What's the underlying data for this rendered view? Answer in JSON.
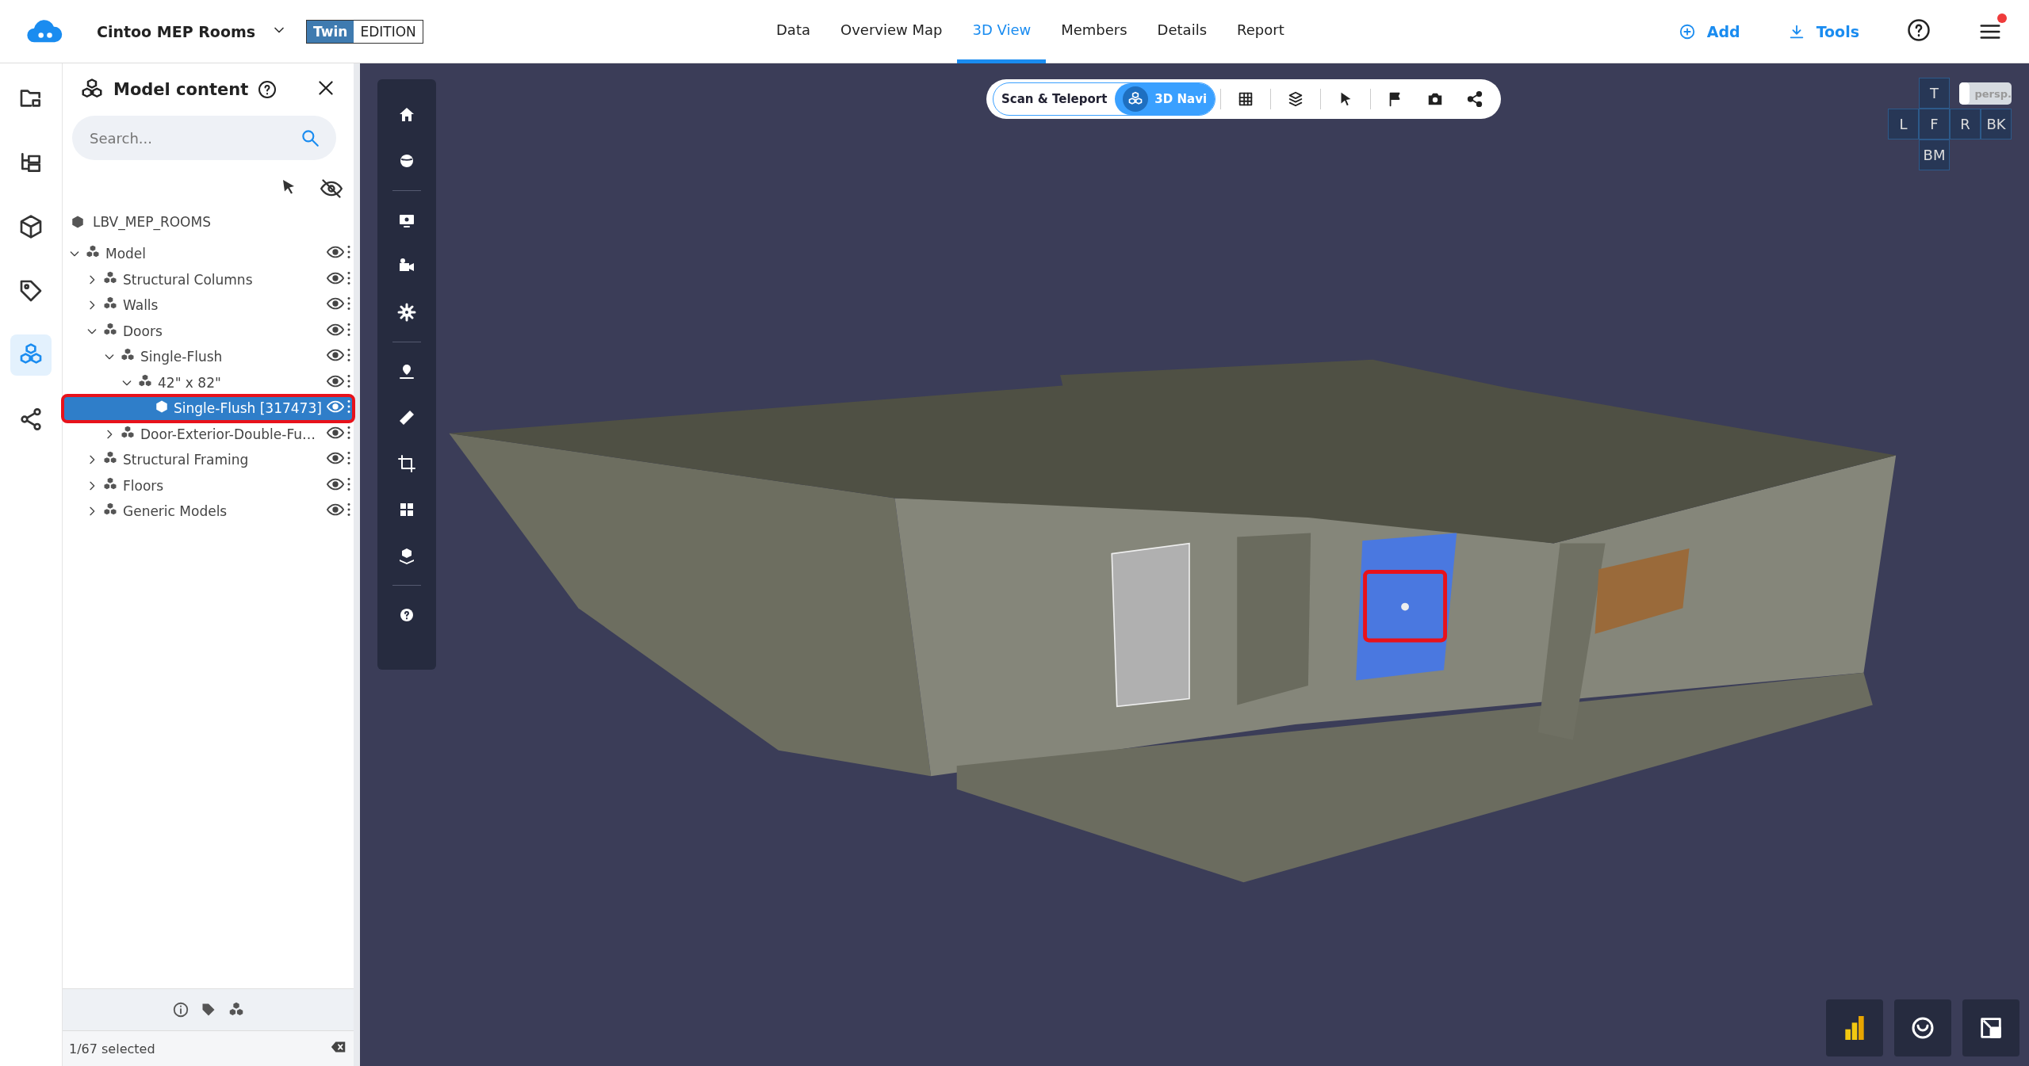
{
  "app": {
    "project": "Cintoo MEP Rooms",
    "edition_primary": "Twin",
    "edition_secondary": "EDITION"
  },
  "nav_tabs": [
    {
      "label": "Data",
      "selected": false
    },
    {
      "label": "Overview Map",
      "selected": false
    },
    {
      "label": "3D View",
      "selected": true
    },
    {
      "label": "Members",
      "selected": false
    },
    {
      "label": "Details",
      "selected": false
    },
    {
      "label": "Report",
      "selected": false
    }
  ],
  "header_actions": [
    {
      "kind": "add",
      "label": "Add"
    },
    {
      "kind": "tools",
      "label": "Tools"
    }
  ],
  "menu": {
    "has_notification": true
  },
  "rail_items": [
    {
      "kind": "folder",
      "selected": false
    },
    {
      "kind": "tree",
      "selected": false
    },
    {
      "kind": "cube",
      "selected": false
    },
    {
      "kind": "tag",
      "selected": false
    },
    {
      "kind": "model",
      "selected": true
    },
    {
      "kind": "share",
      "selected": false
    }
  ],
  "panel": {
    "title": "Model content",
    "search_placeholder": "Search...",
    "root": "LBV_MEP_ROOMS",
    "status": "1/67 selected",
    "tree": [
      {
        "label": "Model",
        "kind": "group",
        "expanded": true,
        "selected": false,
        "children": [
          {
            "label": "Structural Columns",
            "kind": "group",
            "expanded": false,
            "selected": false
          },
          {
            "label": "Walls",
            "kind": "group",
            "expanded": false,
            "selected": false
          },
          {
            "label": "Doors",
            "kind": "group",
            "expanded": true,
            "selected": false,
            "children": [
              {
                "label": "Single-Flush",
                "kind": "group",
                "expanded": true,
                "selected": false,
                "children": [
                  {
                    "label": "42\" x 82\"",
                    "kind": "group",
                    "expanded": true,
                    "selected": false,
                    "children": [
                      {
                        "label": "Single-Flush [317473]",
                        "kind": "element",
                        "selected": true
                      }
                    ]
                  }
                ]
              },
              {
                "label": "Door-Exterior-Double-Fu…",
                "kind": "group",
                "expanded": false,
                "selected": false
              }
            ]
          },
          {
            "label": "Structural Framing",
            "kind": "group",
            "expanded": false,
            "selected": false
          },
          {
            "label": "Floors",
            "kind": "group",
            "expanded": false,
            "selected": false
          },
          {
            "label": "Generic Models",
            "kind": "group",
            "expanded": false,
            "selected": false
          }
        ]
      }
    ]
  },
  "nav_mode": [
    {
      "label": "Scan & Teleport",
      "selected": false
    },
    {
      "label": "3D Navi",
      "selected": true
    }
  ],
  "view_cube": {
    "faces": [
      {
        "kind": "top",
        "label": "T"
      },
      {
        "kind": "left",
        "label": "L"
      },
      {
        "kind": "front",
        "label": "F"
      },
      {
        "kind": "right",
        "label": "R"
      },
      {
        "kind": "back",
        "label": "BK"
      },
      {
        "kind": "bottom",
        "label": "BM"
      }
    ],
    "persp_label": "persp.",
    "persp_on": false
  }
}
